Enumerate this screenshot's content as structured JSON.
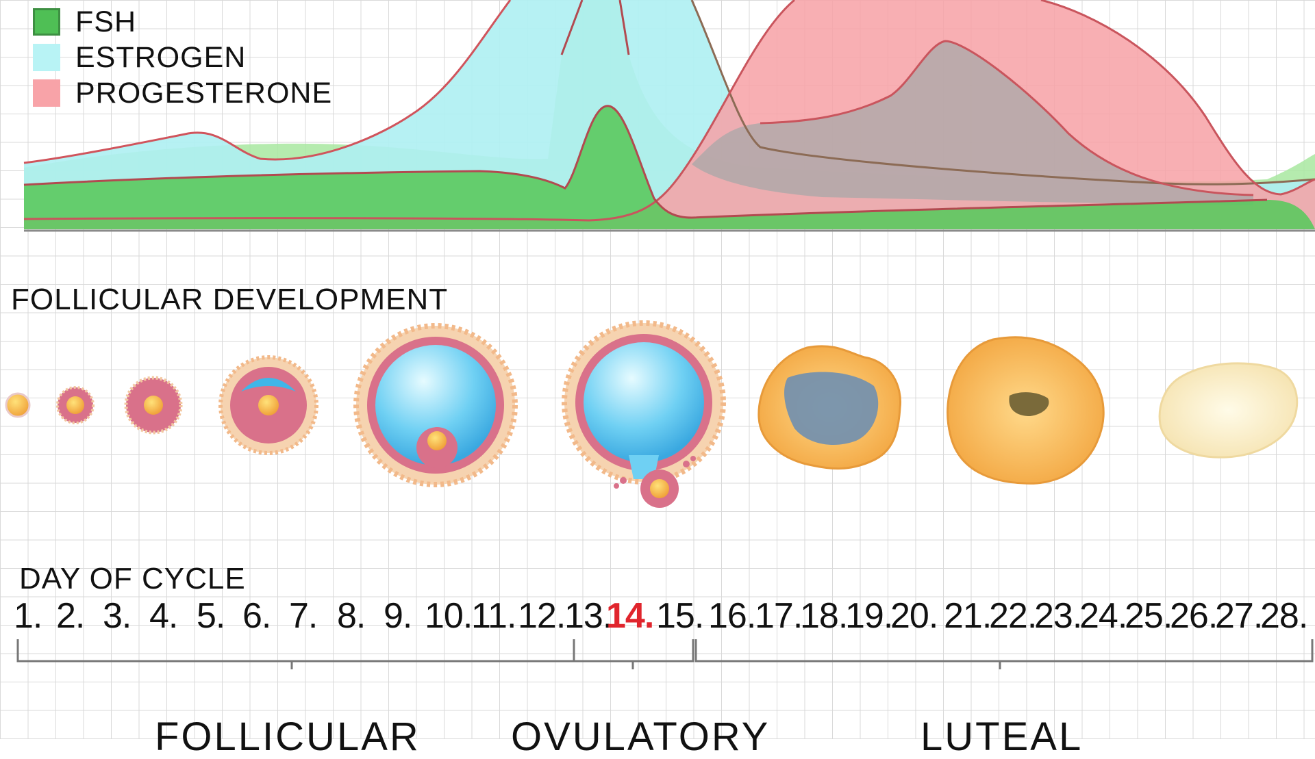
{
  "legend": [
    {
      "label": "FSH",
      "color": "#4fbf55"
    },
    {
      "label": "ESTROGEN",
      "color": "#b8f3f5"
    },
    {
      "label": "PROGESTERONE",
      "color": "#f8a3a8"
    }
  ],
  "section_follicular": "FOLLICULAR DEVELOPMENT",
  "section_day": "DAY OF CYCLE",
  "days": [
    "1.",
    "2.",
    "3.",
    "4.",
    "5.",
    "6.",
    "7.",
    "8.",
    "9.",
    "10.",
    "11.",
    "12.",
    "13.",
    "14.",
    "15.",
    "16.",
    "17.",
    "18.",
    "19.",
    "20.",
    "21.",
    "22.",
    "23.",
    "24.",
    "25.",
    "26.",
    "27.",
    "28."
  ],
  "highlight_day": "14.",
  "highlight_color": "#e0252d",
  "phases": [
    "FOLLICULAR",
    "OVULATORY",
    "LUTEAL"
  ],
  "stages": [
    "primordial-follicle",
    "primary-follicle",
    "secondary-follicle-early",
    "secondary-follicle",
    "antral-follicle",
    "ovulation",
    "corpus-luteum-early",
    "corpus-luteum",
    "corpus-albicans"
  ]
}
